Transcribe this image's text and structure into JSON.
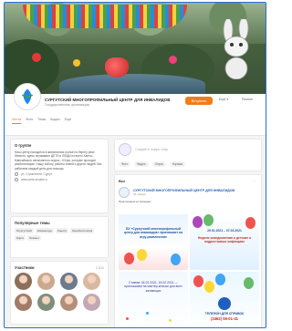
{
  "group": {
    "name": "СУРГУТСКИЙ МНОГОПРОФИЛЬНЫЙ ЦЕНТР ДЛЯ ИНВАЛИДОВ",
    "subtitle": "Государственная организация",
    "join_label": "Вступить",
    "header_links": [
      "Ещё ▾",
      "Разное"
    ]
  },
  "tabs": [
    "Лента",
    "Фото",
    "Темы",
    "Видео",
    "Ещё"
  ],
  "about": {
    "title": "О группе",
    "text": "Наш Центр находится в живописном уголке на берегу реки Кенинга, здесь проживают ДЕТИ и ЛЮДИ из всего Ханты-Мансийского автономного округа – Югры, которые проходят реабилитацию. Нашу заботу, работы семей и других людей. Мы работаем каждый день для помощи.",
    "address": "ул. Строителей, Сургут",
    "site": "www.centr-invalid.ru"
  },
  "topics": {
    "title": "Популярные темы",
    "tags": [
      "#сургутский",
      "#инвалиды",
      "#центр",
      "#реабилитация",
      "#дети",
      "#семья"
    ]
  },
  "members": {
    "title": "Участники",
    "count": "2 512",
    "avatar_colors": [
      "#8b6f5a",
      "#c9a98f",
      "#6b7a8c",
      "#d9b8a0",
      "#a07b66",
      "#7d8f7a",
      "#b38f7a",
      "#c4a7b5"
    ]
  },
  "composer": {
    "placeholder": "Создайте новую тему",
    "actions": [
      "Фото",
      "Видео",
      "Опрос",
      "Музыка"
    ]
  },
  "feed": {
    "label": "Все",
    "post": {
      "author": "СУРГУТСКИЙ МНОГОПРОФИЛЬНЫЙ ЦЕНТР ДЛЯ ИНВАЛИДОВ",
      "date": "25 января",
      "text": "Приглашаем на праздник"
    },
    "images": {
      "img1": "БУ «Сургутский многопрофильный центр для инвалидов» приглашает на игру-развлечение",
      "img2_date": "29.01.2021 – 07.02.2021",
      "img2_text": "Неделя осведомления о детских и подростковых инфекциях",
      "img3": "Ставим: 04.02.2021, 15.02.2021 — приглашаем на мастер-классы для всех желающих",
      "img4_label": "ТЕЛЕФОН ДЛЯ СПРАВОК",
      "img4_phone": "(3462) 55-01-41"
    }
  },
  "colors": {
    "accent": "#f07c1b",
    "link": "#2a64b0",
    "frame": "#2a6fd6"
  }
}
